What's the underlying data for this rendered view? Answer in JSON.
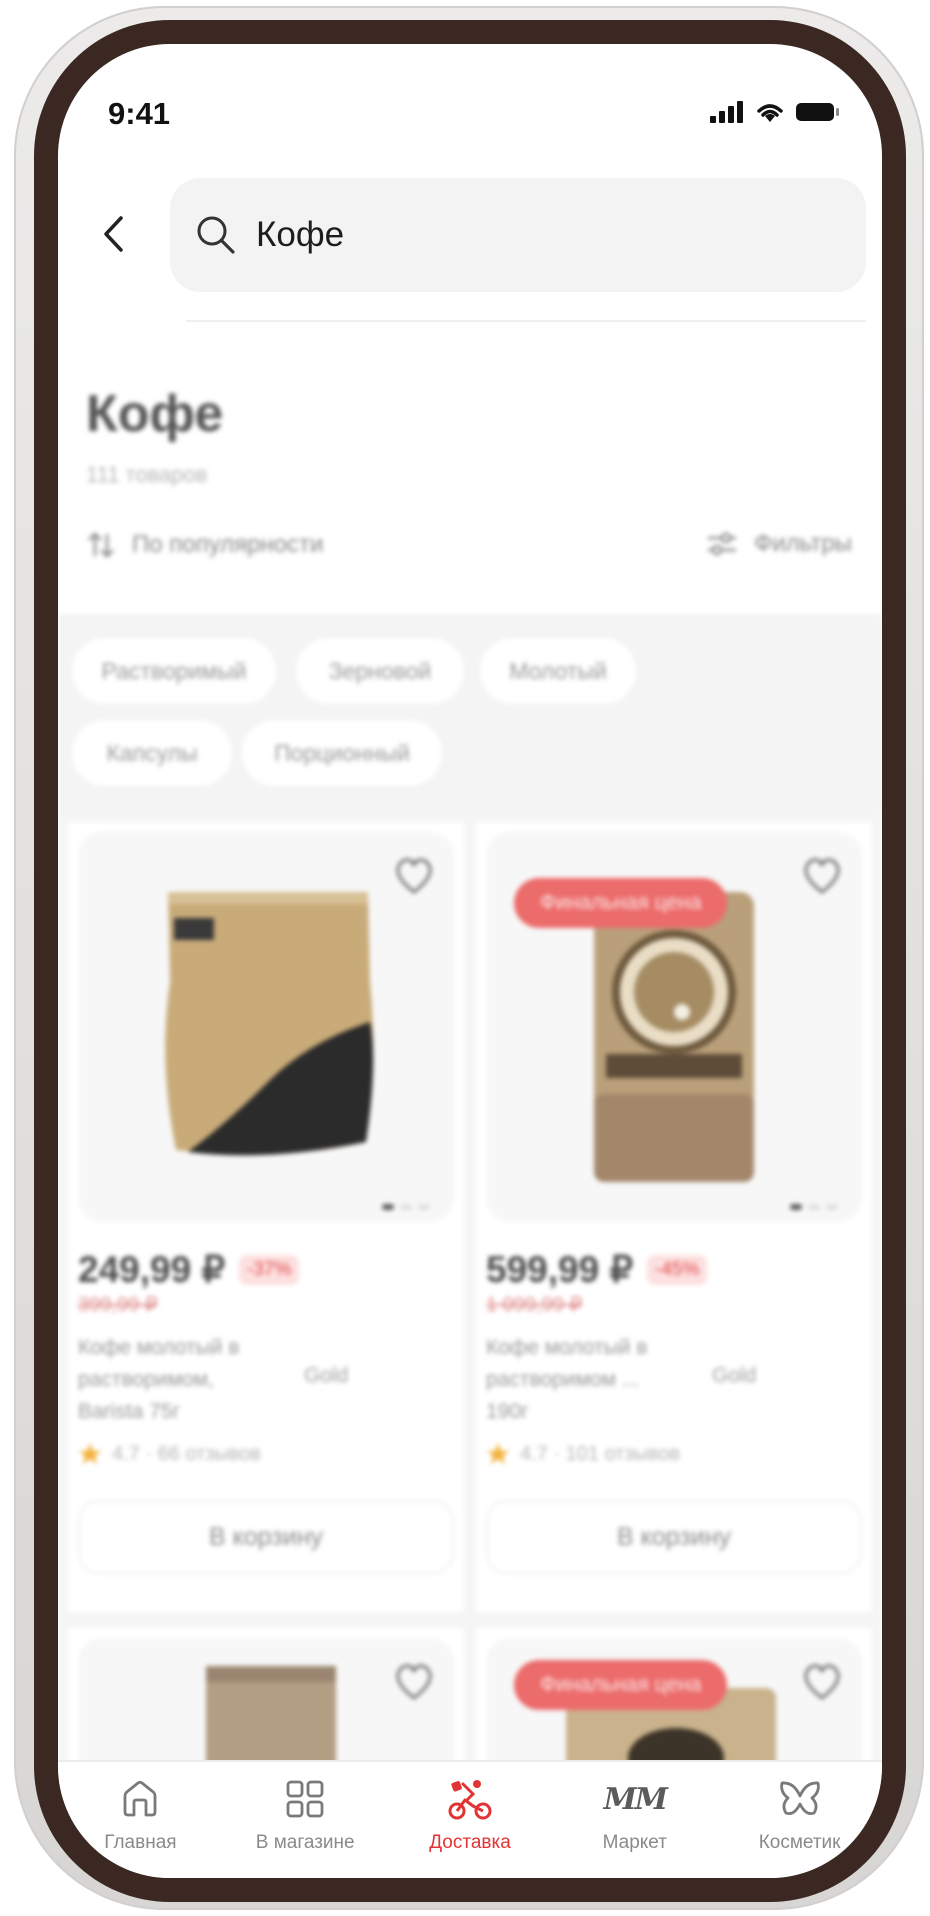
{
  "status_bar": {
    "time": "9:41"
  },
  "search": {
    "query": "Кофе"
  },
  "listing": {
    "title": "Кофе",
    "count": "111 товаров",
    "sort_label": "По популярности",
    "filters_label": "Фильтры"
  },
  "chips": [
    "Растворимый",
    "Зерновой",
    "Молотый",
    "Капсулы",
    "Порционный"
  ],
  "products": [
    {
      "price": "249,99 ₽",
      "discount": "-37%",
      "old_price": "399,99 ₽",
      "name": "Кофе молотый в растворимом, Barista 75г",
      "brand": "Gold",
      "rating": "4.7 · 66 отзывов",
      "cart_label": "В корзину",
      "badge": ""
    },
    {
      "price": "599,99 ₽",
      "discount": "-45%",
      "old_price": "1 099,99 ₽",
      "name": "Кофе молотый в растворимом ... 190г",
      "brand": "Gold",
      "rating": "4.7 · 101 отзывов",
      "cart_label": "В корзину",
      "badge": "Финальная цена"
    },
    {
      "badge": ""
    },
    {
      "badge": "Финальная цена"
    }
  ],
  "tab_bar": {
    "items": [
      {
        "label": "Главная",
        "icon": "home-icon",
        "active": false
      },
      {
        "label": "В магазине",
        "icon": "grid-icon",
        "active": false
      },
      {
        "label": "Доставка",
        "icon": "delivery-icon",
        "active": true
      },
      {
        "label": "Маркет",
        "icon": "mm-logo",
        "logo_text": "MM",
        "active": false
      },
      {
        "label": "Косметик",
        "icon": "butterfly-icon",
        "active": false
      }
    ]
  },
  "colors": {
    "accent": "#e23434",
    "frame": "#3b2822",
    "badge": "#ec6b6b"
  }
}
